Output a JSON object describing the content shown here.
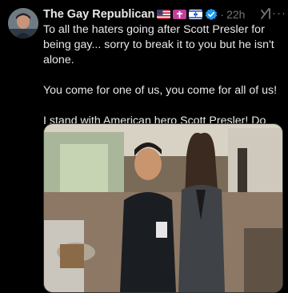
{
  "post": {
    "display_name": "The Gay Republican",
    "time": "22h",
    "separator": "·",
    "more_label": "···",
    "badges": [
      "us-flag-icon",
      "cross-icon",
      "israel-flag-icon",
      "verified-icon"
    ],
    "body_paragraphs": [
      "To all the haters going after Scott Presler for being gay... sorry to break it to you but he isn't alone.",
      "You come for one of us, you come for all of us!",
      "I stand with American hero Scott Presler! Do you?"
    ],
    "media_alt": "Two men posing together at an indoor event",
    "colors": {
      "background": "#000000",
      "text": "#e7e9ea",
      "secondary_text": "#71767b",
      "verified": "#1d9bf0",
      "cross_badge": "#c13f9b"
    }
  }
}
